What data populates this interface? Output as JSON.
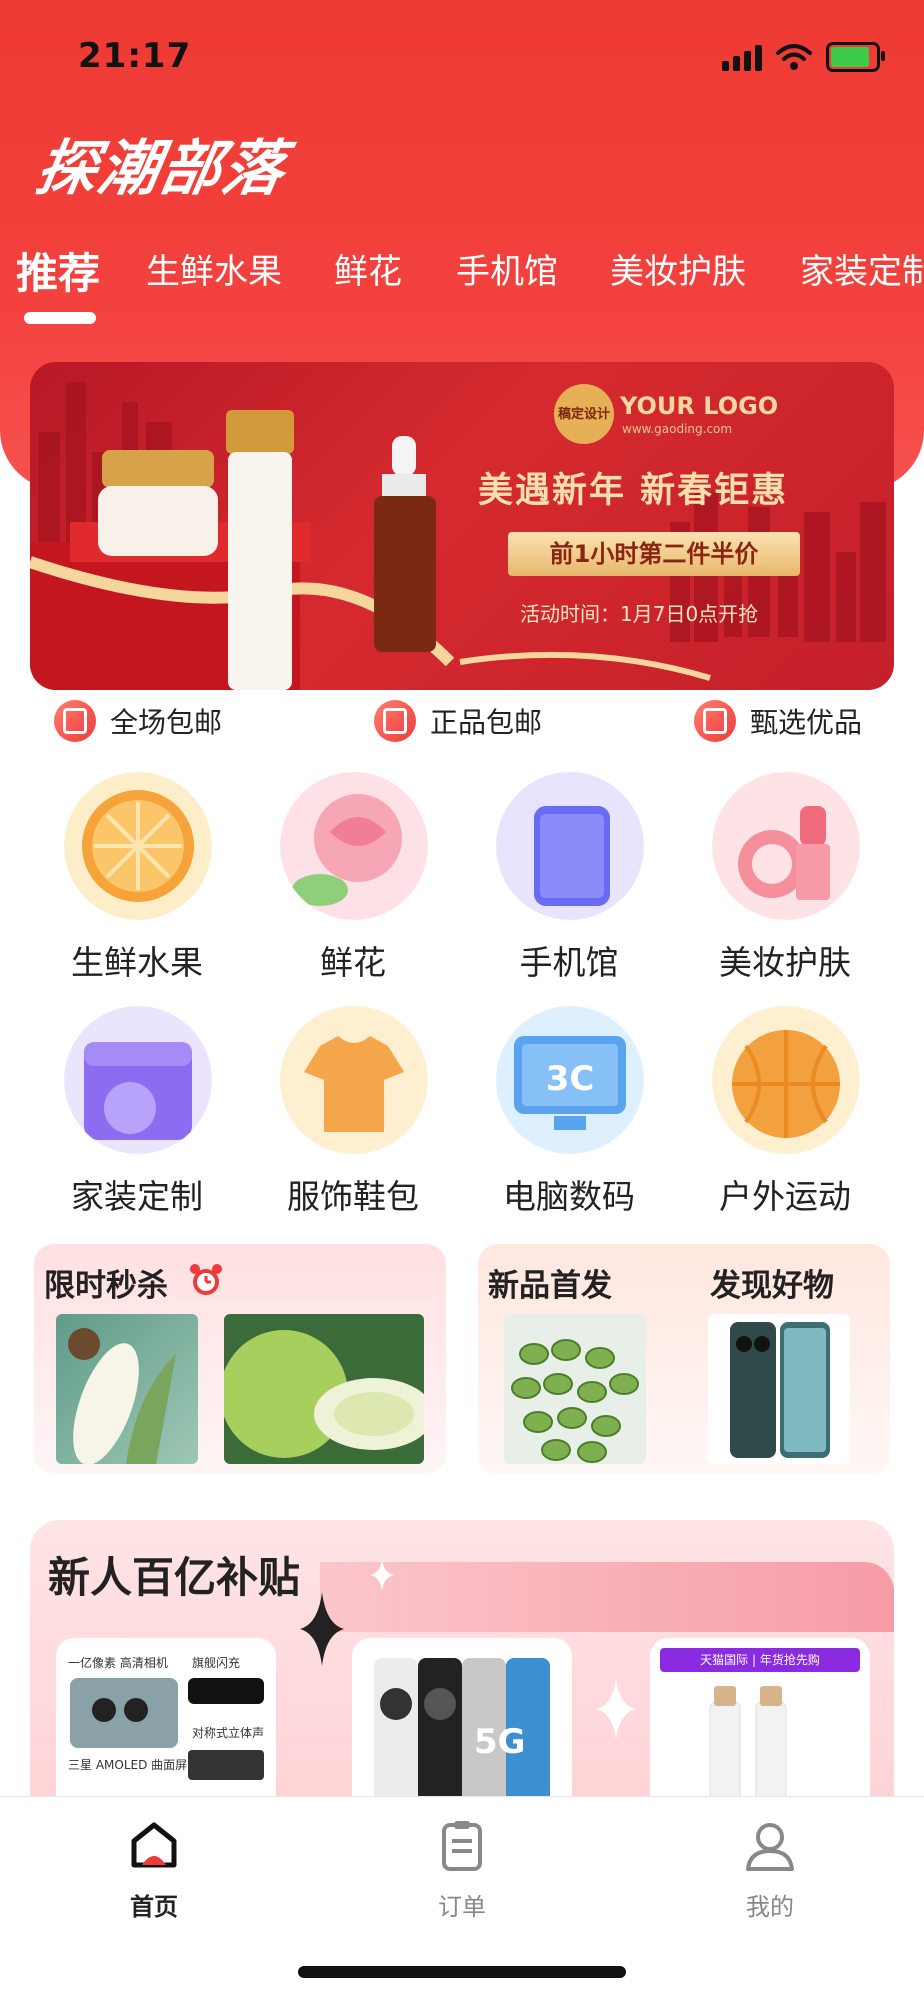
{
  "status_bar": {
    "time": "21:17"
  },
  "app": {
    "logo_text": "探潮部落"
  },
  "category_tabs": [
    {
      "label": "推荐",
      "active": true
    },
    {
      "label": "生鲜水果",
      "active": false
    },
    {
      "label": "鲜花",
      "active": false
    },
    {
      "label": "手机馆",
      "active": false
    },
    {
      "label": "美妆护肤",
      "active": false
    },
    {
      "label": "家装定制",
      "active": false
    }
  ],
  "banner": {
    "badge_text": "稿定设计",
    "logo_text": "YOUR LOGO",
    "logo_url": "www.gaoding.com",
    "title": "美遇新年 新春钜惠",
    "promo": "前1小时第二件半价",
    "subtitle": "活动时间：1月7日0点开抢"
  },
  "features": [
    {
      "label": "全场包邮",
      "icon": "box-icon"
    },
    {
      "label": "正品包邮",
      "icon": "genuine-icon"
    },
    {
      "label": "甄选优品",
      "icon": "premium-icon"
    }
  ],
  "categories": [
    {
      "label": "生鲜水果",
      "icon": "orange-icon"
    },
    {
      "label": "鲜花",
      "icon": "rose-icon"
    },
    {
      "label": "手机馆",
      "icon": "phone-icon"
    },
    {
      "label": "美妆护肤",
      "icon": "lipstick-icon"
    },
    {
      "label": "家装定制",
      "icon": "washer-icon"
    },
    {
      "label": "服饰鞋包",
      "icon": "tshirt-icon"
    },
    {
      "label": "电脑数码",
      "icon": "monitor-3c-icon"
    },
    {
      "label": "户外运动",
      "icon": "basketball-icon"
    }
  ],
  "promos": {
    "flash_sale": {
      "title": "限时秒杀",
      "icon": "alarm-clock-icon"
    },
    "new_arrivals": {
      "title": "新品首发"
    },
    "discover": {
      "title": "发现好物"
    }
  },
  "subsidy": {
    "title": "新人百亿补贴",
    "cards": [
      {
        "lines": [
          "一亿像素 高清相机",
          "旗舰闪充",
          "对称式立体声",
          "三星 AMOLED 曲面屏"
        ]
      },
      {
        "badge": "5G"
      },
      {
        "header": "天猫国际 | 年货抢先购"
      }
    ]
  },
  "bottom_nav": [
    {
      "label": "首页",
      "icon": "home-icon",
      "active": true
    },
    {
      "label": "订单",
      "icon": "clipboard-icon",
      "active": false
    },
    {
      "label": "我的",
      "icon": "user-icon",
      "active": false
    }
  ]
}
